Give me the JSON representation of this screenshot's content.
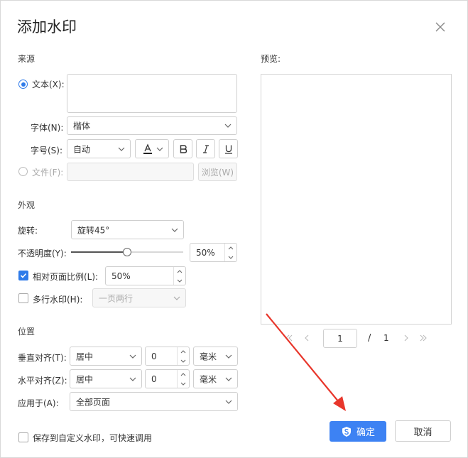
{
  "dialog": {
    "title": "添加水印"
  },
  "source": {
    "section_label": "来源",
    "text_option_label": "文本(X):",
    "text_value": "",
    "font_label": "字体(N):",
    "font_value": "楷体",
    "size_label": "字号(S):",
    "size_value": "自动",
    "file_option_label": "文件(F):",
    "file_value": "",
    "browse_label": "浏览(W)",
    "selected": "text"
  },
  "appearance": {
    "section_label": "外观",
    "rotation_label": "旋转:",
    "rotation_value": "旋转45°",
    "opacity_label": "不透明度(Y):",
    "opacity_value": "50%",
    "opacity_fraction": 0.5,
    "relative_scale_label": "相对页面比例(L):",
    "relative_scale_checked": true,
    "relative_scale_value": "50%",
    "multiline_label": "多行水印(H):",
    "multiline_checked": false,
    "multiline_value": "一页两行"
  },
  "position": {
    "section_label": "位置",
    "vertical_label": "垂直对齐(T):",
    "vertical_align_value": "居中",
    "vertical_offset_value": "0",
    "vertical_unit_value": "毫米",
    "horizontal_label": "水平对齐(Z):",
    "horizontal_align_value": "居中",
    "horizontal_offset_value": "0",
    "horizontal_unit_value": "毫米",
    "apply_label": "应用于(A):",
    "apply_value": "全部页面"
  },
  "preview": {
    "label": "预览:",
    "page_current": "1",
    "page_separator": "/",
    "page_total": "1"
  },
  "footer": {
    "save_custom_label": "保存到自定义水印，可快速调用",
    "save_custom_checked": false,
    "confirm_label": "确定",
    "cancel_label": "取消"
  },
  "colors": {
    "accent": "#3d82f3",
    "arrow": "#e8362b"
  }
}
